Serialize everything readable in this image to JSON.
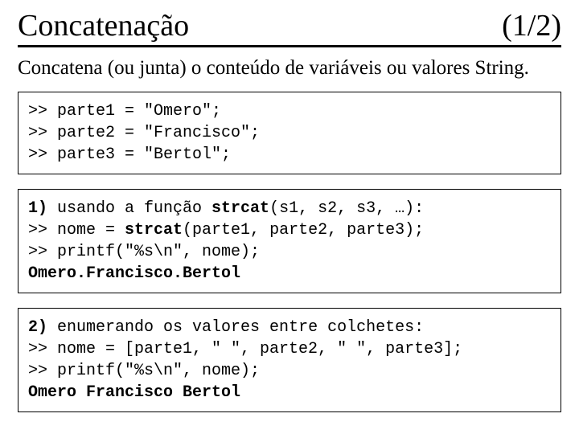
{
  "header": {
    "title": "Concatenação",
    "page": "(1/2)"
  },
  "subtitle": "Concatena (ou junta) o conteúdo de variáveis ou valores String.",
  "code1": {
    "l1": ">> parte1 = \"Omero\";",
    "l2": ">> parte2 = \"Francisco\";",
    "l3": ">> parte3 = \"Bertol\";"
  },
  "code2": {
    "l1a": "1) ",
    "l1b": "usando a função ",
    "l1c": "strcat",
    "l1d": "(s1, s2, s3, …):",
    "l2a": ">> nome = ",
    "l2b": "strcat",
    "l2c": "(parte1, parte2, parte3);",
    "l3": ">> printf(\"%s\\n\", nome);",
    "l4": "Omero.Francisco.Bertol"
  },
  "code3": {
    "l1a": "2) ",
    "l1b": "enumerando os valores entre colchetes:",
    "l2": ">> nome = [parte1, \" \", parte2, \" \", parte3];",
    "l3": ">> printf(\"%s\\n\", nome);",
    "l4": "Omero Francisco Bertol"
  }
}
